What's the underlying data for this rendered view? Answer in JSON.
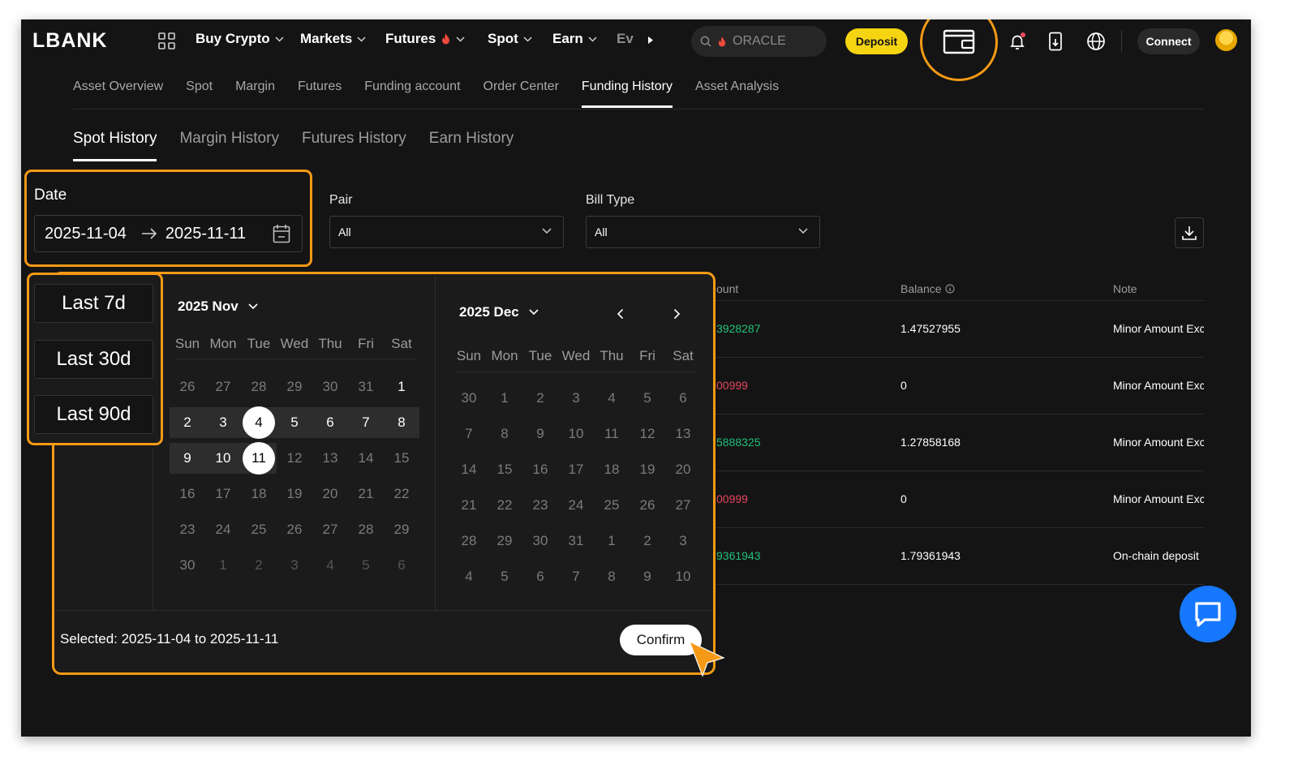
{
  "brand": {
    "logo": "LBANK"
  },
  "topnav": {
    "items": [
      {
        "label": "Buy Crypto"
      },
      {
        "label": "Markets"
      },
      {
        "label": "Futures"
      },
      {
        "label": "Spot"
      },
      {
        "label": "Earn"
      },
      {
        "label": "Ev"
      }
    ],
    "search_value": "ORACLE",
    "deposit_label": "Deposit",
    "connect_label": "Connect"
  },
  "subnav": {
    "items": [
      "Asset Overview",
      "Spot",
      "Margin",
      "Futures",
      "Funding account",
      "Order Center",
      "Funding History",
      "Asset Analysis"
    ],
    "active": "Funding History"
  },
  "tabs": {
    "items": [
      "Spot History",
      "Margin History",
      "Futures History",
      "Earn History"
    ],
    "active": "Spot History"
  },
  "filters": {
    "date_label": "Date",
    "date_start": "2025-11-04",
    "date_end": "2025-11-11",
    "pair_label": "Pair",
    "pair_value": "All",
    "bill_type_label": "Bill Type",
    "bill_type_value": "All"
  },
  "table": {
    "headers": {
      "amount": "ount",
      "balance": "Balance",
      "note": "Note"
    },
    "rows": [
      {
        "amount": "3928287",
        "amount_sign": "pos",
        "balance": "1.47527955",
        "note": "Minor Amount Exc"
      },
      {
        "amount": "00999",
        "amount_sign": "neg",
        "balance": "0",
        "note": "Minor Amount Exc"
      },
      {
        "amount": "5888325",
        "amount_sign": "pos",
        "balance": "1.27858168",
        "note": "Minor Amount Exc"
      },
      {
        "amount": "00999",
        "amount_sign": "neg",
        "balance": "0",
        "note": "Minor Amount Exc"
      },
      {
        "amount": "9361943",
        "amount_sign": "pos",
        "balance": "1.79361943",
        "note": "On-chain deposit"
      }
    ]
  },
  "calendar": {
    "presets": [
      "Last 7d",
      "Last 30d",
      "Last 90d"
    ],
    "weekdays": [
      "Sun",
      "Mon",
      "Tue",
      "Wed",
      "Thu",
      "Fri",
      "Sat"
    ],
    "left_month": "2025 Nov",
    "right_month": "2025 Dec",
    "left_days": [
      [
        "26",
        "27",
        "28",
        "29",
        "30",
        "31",
        "1"
      ],
      [
        "2",
        "3",
        "4",
        "5",
        "6",
        "7",
        "8"
      ],
      [
        "9",
        "10",
        "11",
        "12",
        "13",
        "14",
        "15"
      ],
      [
        "16",
        "17",
        "18",
        "19",
        "20",
        "21",
        "22"
      ],
      [
        "23",
        "24",
        "25",
        "26",
        "27",
        "28",
        "29"
      ],
      [
        "30",
        "1",
        "2",
        "3",
        "4",
        "5",
        "6"
      ]
    ],
    "right_days": [
      [
        "30",
        "1",
        "2",
        "3",
        "4",
        "5",
        "6"
      ],
      [
        "7",
        "8",
        "9",
        "10",
        "11",
        "12",
        "13"
      ],
      [
        "14",
        "15",
        "16",
        "17",
        "18",
        "19",
        "20"
      ],
      [
        "21",
        "22",
        "23",
        "24",
        "25",
        "26",
        "27"
      ],
      [
        "28",
        "29",
        "30",
        "31",
        "1",
        "2",
        "3"
      ],
      [
        "4",
        "5",
        "6",
        "7",
        "8",
        "9",
        "10"
      ]
    ],
    "selected_text": "Selected: 2025-11-04 to 2025-11-11",
    "confirm_label": "Confirm"
  },
  "colors": {
    "highlight": "#f59a16",
    "deposit": "#f5d412",
    "positive": "#22c07a",
    "negative": "#e5465e",
    "chat": "#1677ff"
  }
}
